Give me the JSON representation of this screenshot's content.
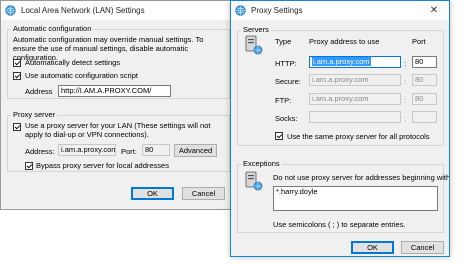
{
  "lan": {
    "title": "Local Area Network (LAN) Settings",
    "auto_group": "Automatic configuration",
    "auto_desc": "Automatic configuration may override manual settings. To ensure the use of manual settings, disable automatic configuration.",
    "auto_detect_label": "Automatically detect settings",
    "auto_detect_checked": true,
    "auto_script_label": "Use automatic configuration script",
    "auto_script_checked": true,
    "address_label": "Address",
    "address_value": "http://I.AM.A.PROXY.COM/",
    "proxy_group": "Proxy server",
    "use_proxy_label": "Use a proxy server for your LAN (These settings will not apply to dial-up or VPN connections).",
    "use_proxy_checked": true,
    "proxy_address_label": "Address:",
    "proxy_address_value": "i.am.a.proxy.com",
    "port_label": "Port:",
    "port_value": "80",
    "advanced_button": "Advanced",
    "bypass_label": "Bypass proxy server for local addresses",
    "bypass_checked": true,
    "ok_button": "OK",
    "cancel_button": "Cancel"
  },
  "proxy": {
    "title": "Proxy Settings",
    "close_glyph": "✕",
    "servers_group": "Servers",
    "type_header": "Type",
    "address_header": "Proxy address to use",
    "port_header": "Port",
    "rows": [
      {
        "label": "HTTP:",
        "address": "i.am.a.proxy.com",
        "port": "80",
        "sep": ":",
        "enabled": true,
        "selected": true
      },
      {
        "label": "Secure:",
        "address": "i.am.a.proxy.com",
        "port": "80",
        "sep": ":",
        "enabled": false,
        "selected": false
      },
      {
        "label": "FTP:",
        "address": "i.am.a.proxy.com",
        "port": "80",
        "sep": ":",
        "enabled": false,
        "selected": false
      },
      {
        "label": "Socks:",
        "address": "",
        "port": "",
        "sep": ":",
        "enabled": false,
        "selected": false
      }
    ],
    "same_proxy_label": "Use the same proxy server for all protocols",
    "same_proxy_checked": true,
    "exceptions_group": "Exceptions",
    "exceptions_desc": "Do not use proxy server for addresses beginning with:",
    "exceptions_value": "*.harry.doyle",
    "semicolons_hint": "Use semicolons ( ; ) to separate entries.",
    "ok_button": "OK",
    "cancel_button": "Cancel"
  }
}
